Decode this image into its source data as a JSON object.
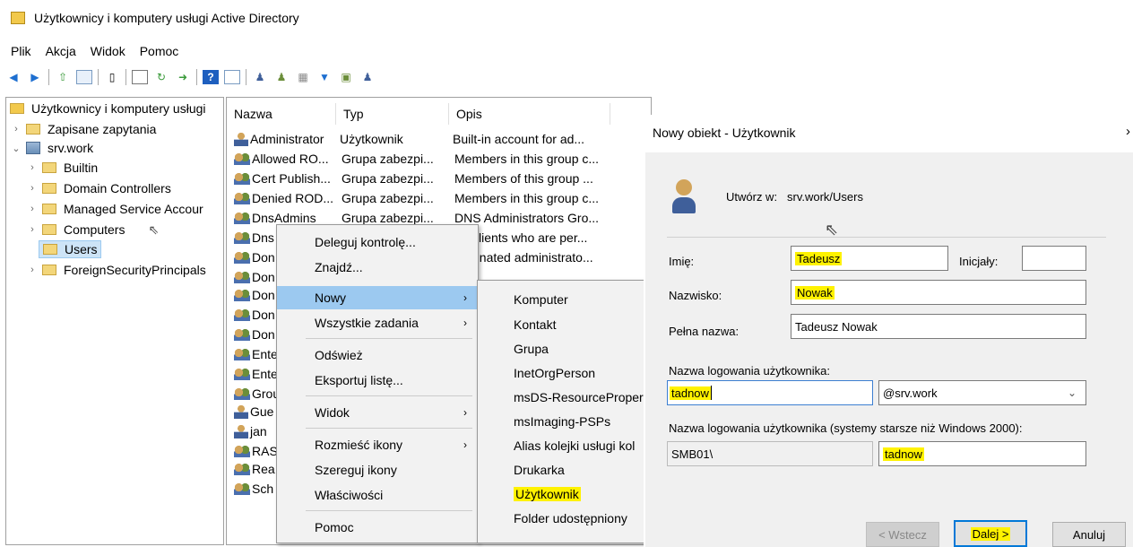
{
  "window": {
    "title": "Użytkownicy i komputery usługi Active Directory"
  },
  "menu": [
    "Plik",
    "Akcja",
    "Widok",
    "Pomoc"
  ],
  "tree": {
    "root": "Użytkownicy i komputery usługi",
    "items": [
      {
        "label": "Zapisane zapytania"
      },
      {
        "label": "srv.work"
      },
      {
        "label": "Builtin"
      },
      {
        "label": "Domain Controllers"
      },
      {
        "label": "Managed Service Accour"
      },
      {
        "label": "Computers"
      },
      {
        "label": "Users"
      },
      {
        "label": "ForeignSecurityPrincipals"
      }
    ]
  },
  "list": {
    "columns": [
      "Nazwa",
      "Typ",
      "Opis"
    ],
    "rows": [
      {
        "name": "Administrator",
        "type": "Użytkownik",
        "desc": "Built-in account for ad..."
      },
      {
        "name": "Allowed RO...",
        "type": "Grupa zabezpi...",
        "desc": "Members in this group c..."
      },
      {
        "name": "Cert Publish...",
        "type": "Grupa zabezpi...",
        "desc": "Members of this group ..."
      },
      {
        "name": "Denied ROD...",
        "type": "Grupa zabezpi...",
        "desc": "Members in this group c..."
      },
      {
        "name": "DnsAdmins",
        "type": "Grupa zabezpi...",
        "desc": "DNS Administrators Gro..."
      },
      {
        "name": "Dns",
        "type": "",
        "desc": "clients who are per..."
      },
      {
        "name": "Don",
        "type": "",
        "desc": "gnated administrato..."
      },
      {
        "name": "Don",
        "type": "",
        "desc": ""
      },
      {
        "name": "Don",
        "type": "",
        "desc": ""
      },
      {
        "name": "Don",
        "type": "",
        "desc": ""
      },
      {
        "name": "Don",
        "type": "",
        "desc": ""
      },
      {
        "name": "Ente",
        "type": "",
        "desc": ""
      },
      {
        "name": "Ente",
        "type": "",
        "desc": ""
      },
      {
        "name": "Grou",
        "type": "",
        "desc": ""
      },
      {
        "name": "Gue",
        "type": "",
        "desc": ""
      },
      {
        "name": "jan",
        "type": "",
        "desc": ""
      },
      {
        "name": "RAS",
        "type": "",
        "desc": ""
      },
      {
        "name": "Rea",
        "type": "",
        "desc": ""
      },
      {
        "name": "Sch",
        "type": "",
        "desc": ""
      }
    ]
  },
  "context_menu": {
    "items": [
      "Deleguj kontrolę...",
      "Znajdź...",
      "Nowy",
      "Wszystkie zadania",
      "Odśwież",
      "Eksportuj listę...",
      "Widok",
      "Rozmieść ikony",
      "Szereguj ikony",
      "Właściwości",
      "Pomoc"
    ]
  },
  "submenu": {
    "items": [
      "Komputer",
      "Kontakt",
      "Grupa",
      "InetOrgPerson",
      "msDS-ResourceProper",
      "msImaging-PSPs",
      "Alias kolejki usługi kol",
      "Drukarka",
      "Użytkownik",
      "Folder udostępniony"
    ]
  },
  "dialog": {
    "title": "Nowy obiekt - Użytkownik",
    "close": "›",
    "create_in_label": "Utwórz w:",
    "create_in_value": "srv.work/Users",
    "first_name_label": "Imię:",
    "first_name": "Tadeusz",
    "initials_label": "Inicjały:",
    "initials": "",
    "last_name_label": "Nazwisko:",
    "last_name": "Nowak",
    "full_name_label": "Pełna nazwa:",
    "full_name": "Tadeusz Nowak",
    "logon_label": "Nazwa logowania użytkownika:",
    "logon": "tadnow",
    "domain_suffix": "@srv.work",
    "legacy_label": "Nazwa logowania użytkownika (systemy starsze niż Windows 2000):",
    "legacy_domain": "SMB01\\",
    "legacy_logon": "tadnow",
    "back_button": "< Wstecz",
    "next_button": "Dalej >",
    "cancel_button": "Anuluj"
  },
  "colors": {
    "highlight": "#fff200",
    "selection": "#cde4f7",
    "menu_highlight": "#9cc9f0",
    "accent": "#0078d7"
  }
}
